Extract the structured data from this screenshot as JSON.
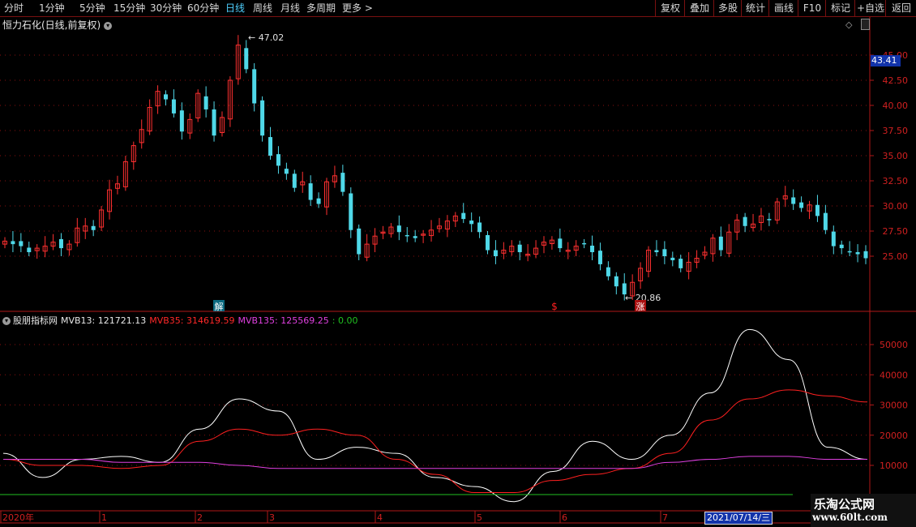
{
  "toolbar": {
    "periods": [
      "分时",
      "1分钟",
      "5分钟",
      "15分钟",
      "30分钟",
      "60分钟",
      "日线",
      "周线",
      "月线",
      "多周期",
      "更多 >"
    ],
    "active_period": "日线",
    "buttons": [
      "复权",
      "叠加",
      "多股",
      "统计",
      "画线",
      "F10",
      "标记",
      "+自选",
      "返回"
    ]
  },
  "main_chart": {
    "title": "恒力石化(日线,前复权)",
    "high_label": "47.02",
    "low_label": "20.86",
    "current_price": "43.41",
    "y_ticks": [
      "45.00",
      "42.50",
      "40.00",
      "37.50",
      "35.00",
      "32.50",
      "30.00",
      "27.50",
      "25.00"
    ],
    "markers": {
      "jie": "解",
      "dollar": "$",
      "zhang": "涨"
    }
  },
  "indicator": {
    "name": "股朋指标网",
    "mvb13": "MVB13: 121721.13",
    "mvb35": "MVB35: 314619.59",
    "mvb135": "MVB135: 125569.25",
    "zero": ": 0.00",
    "y_ticks": [
      "50000",
      "40000",
      "30000",
      "20000",
      "10000"
    ],
    "colors": {
      "mvb13": "#ffffff",
      "mvb35": "#ff2020",
      "mvb135": "#e040e0",
      "zero": "#20c020"
    }
  },
  "x_axis": {
    "labels": [
      "2020年",
      "1",
      "2",
      "3",
      "4",
      "5",
      "6",
      "7"
    ],
    "cursor_date": "2021/07/14/三"
  },
  "watermark": {
    "line1": "乐淘公式网",
    "line2": "www.60lt.com"
  },
  "chart_data": {
    "type": "line",
    "title": "股朋指标网",
    "x": [
      "2020年",
      "1",
      "2",
      "3",
      "4",
      "5",
      "6",
      "7"
    ],
    "ylim": [
      0,
      55000
    ],
    "series": [
      {
        "name": "MVB13",
        "values": [
          14000,
          6000,
          12000,
          13000,
          11000,
          22000,
          32000,
          28000,
          12000,
          16000,
          14000,
          6000,
          3000,
          -2000,
          8000,
          18000,
          12000,
          20000,
          34000,
          55000,
          45000,
          16000,
          12000
        ]
      },
      {
        "name": "MVB35",
        "values": [
          12000,
          10000,
          10000,
          9000,
          10000,
          18000,
          22000,
          20000,
          22000,
          20000,
          12000,
          7000,
          1000,
          1000,
          5000,
          7000,
          9000,
          14000,
          25000,
          32000,
          35000,
          33000,
          31000
        ]
      },
      {
        "name": "MVB135",
        "values": [
          12000,
          12000,
          12000,
          11000,
          11000,
          11000,
          10000,
          9000,
          9000,
          9000,
          9000,
          9000,
          9000,
          9000,
          9000,
          9000,
          9000,
          11000,
          12000,
          13000,
          13000,
          12000,
          12000
        ]
      }
    ]
  }
}
